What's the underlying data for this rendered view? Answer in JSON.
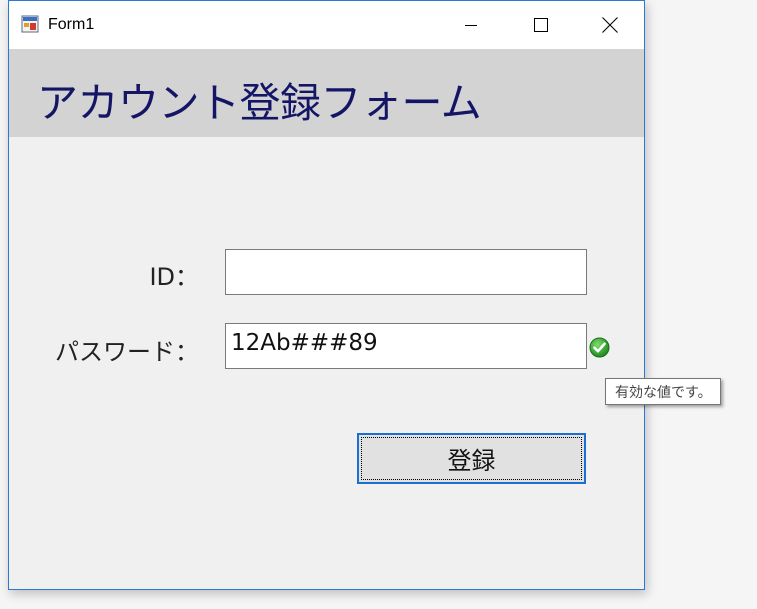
{
  "window": {
    "title": "Form1"
  },
  "header": {
    "title": "アカウント登録フォーム",
    "background": "#d3d3d3",
    "text_color": "#151566"
  },
  "form": {
    "id_label": "ID：",
    "id_value": "",
    "password_label": "パスワード：",
    "password_value": "12Ab###89",
    "validation_icon": "check-circle-icon",
    "validation_tooltip": "有効な値です。",
    "submit_label": "登録"
  },
  "colors": {
    "accent": "#1a6fd1",
    "valid": "#2e9e2e"
  }
}
